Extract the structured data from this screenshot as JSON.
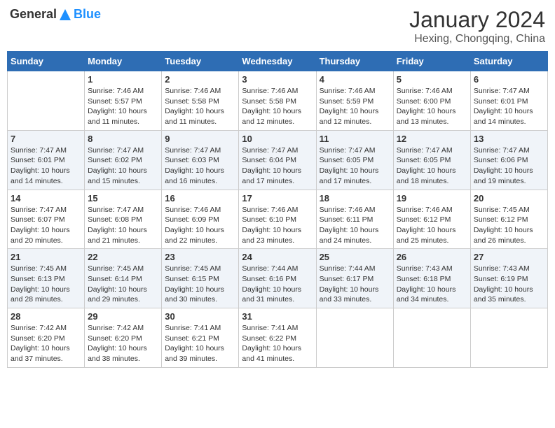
{
  "header": {
    "logo_general": "General",
    "logo_blue": "Blue",
    "month_title": "January 2024",
    "subtitle": "Hexing, Chongqing, China"
  },
  "days_of_week": [
    "Sunday",
    "Monday",
    "Tuesday",
    "Wednesday",
    "Thursday",
    "Friday",
    "Saturday"
  ],
  "weeks": [
    {
      "days": [
        {
          "num": "",
          "info": ""
        },
        {
          "num": "1",
          "info": "Sunrise: 7:46 AM\nSunset: 5:57 PM\nDaylight: 10 hours\nand 11 minutes."
        },
        {
          "num": "2",
          "info": "Sunrise: 7:46 AM\nSunset: 5:58 PM\nDaylight: 10 hours\nand 11 minutes."
        },
        {
          "num": "3",
          "info": "Sunrise: 7:46 AM\nSunset: 5:58 PM\nDaylight: 10 hours\nand 12 minutes."
        },
        {
          "num": "4",
          "info": "Sunrise: 7:46 AM\nSunset: 5:59 PM\nDaylight: 10 hours\nand 12 minutes."
        },
        {
          "num": "5",
          "info": "Sunrise: 7:46 AM\nSunset: 6:00 PM\nDaylight: 10 hours\nand 13 minutes."
        },
        {
          "num": "6",
          "info": "Sunrise: 7:47 AM\nSunset: 6:01 PM\nDaylight: 10 hours\nand 14 minutes."
        }
      ]
    },
    {
      "days": [
        {
          "num": "7",
          "info": "Sunrise: 7:47 AM\nSunset: 6:01 PM\nDaylight: 10 hours\nand 14 minutes."
        },
        {
          "num": "8",
          "info": "Sunrise: 7:47 AM\nSunset: 6:02 PM\nDaylight: 10 hours\nand 15 minutes."
        },
        {
          "num": "9",
          "info": "Sunrise: 7:47 AM\nSunset: 6:03 PM\nDaylight: 10 hours\nand 16 minutes."
        },
        {
          "num": "10",
          "info": "Sunrise: 7:47 AM\nSunset: 6:04 PM\nDaylight: 10 hours\nand 17 minutes."
        },
        {
          "num": "11",
          "info": "Sunrise: 7:47 AM\nSunset: 6:05 PM\nDaylight: 10 hours\nand 17 minutes."
        },
        {
          "num": "12",
          "info": "Sunrise: 7:47 AM\nSunset: 6:05 PM\nDaylight: 10 hours\nand 18 minutes."
        },
        {
          "num": "13",
          "info": "Sunrise: 7:47 AM\nSunset: 6:06 PM\nDaylight: 10 hours\nand 19 minutes."
        }
      ]
    },
    {
      "days": [
        {
          "num": "14",
          "info": "Sunrise: 7:47 AM\nSunset: 6:07 PM\nDaylight: 10 hours\nand 20 minutes."
        },
        {
          "num": "15",
          "info": "Sunrise: 7:47 AM\nSunset: 6:08 PM\nDaylight: 10 hours\nand 21 minutes."
        },
        {
          "num": "16",
          "info": "Sunrise: 7:46 AM\nSunset: 6:09 PM\nDaylight: 10 hours\nand 22 minutes."
        },
        {
          "num": "17",
          "info": "Sunrise: 7:46 AM\nSunset: 6:10 PM\nDaylight: 10 hours\nand 23 minutes."
        },
        {
          "num": "18",
          "info": "Sunrise: 7:46 AM\nSunset: 6:11 PM\nDaylight: 10 hours\nand 24 minutes."
        },
        {
          "num": "19",
          "info": "Sunrise: 7:46 AM\nSunset: 6:12 PM\nDaylight: 10 hours\nand 25 minutes."
        },
        {
          "num": "20",
          "info": "Sunrise: 7:45 AM\nSunset: 6:12 PM\nDaylight: 10 hours\nand 26 minutes."
        }
      ]
    },
    {
      "days": [
        {
          "num": "21",
          "info": "Sunrise: 7:45 AM\nSunset: 6:13 PM\nDaylight: 10 hours\nand 28 minutes."
        },
        {
          "num": "22",
          "info": "Sunrise: 7:45 AM\nSunset: 6:14 PM\nDaylight: 10 hours\nand 29 minutes."
        },
        {
          "num": "23",
          "info": "Sunrise: 7:45 AM\nSunset: 6:15 PM\nDaylight: 10 hours\nand 30 minutes."
        },
        {
          "num": "24",
          "info": "Sunrise: 7:44 AM\nSunset: 6:16 PM\nDaylight: 10 hours\nand 31 minutes."
        },
        {
          "num": "25",
          "info": "Sunrise: 7:44 AM\nSunset: 6:17 PM\nDaylight: 10 hours\nand 33 minutes."
        },
        {
          "num": "26",
          "info": "Sunrise: 7:43 AM\nSunset: 6:18 PM\nDaylight: 10 hours\nand 34 minutes."
        },
        {
          "num": "27",
          "info": "Sunrise: 7:43 AM\nSunset: 6:19 PM\nDaylight: 10 hours\nand 35 minutes."
        }
      ]
    },
    {
      "days": [
        {
          "num": "28",
          "info": "Sunrise: 7:42 AM\nSunset: 6:20 PM\nDaylight: 10 hours\nand 37 minutes."
        },
        {
          "num": "29",
          "info": "Sunrise: 7:42 AM\nSunset: 6:20 PM\nDaylight: 10 hours\nand 38 minutes."
        },
        {
          "num": "30",
          "info": "Sunrise: 7:41 AM\nSunset: 6:21 PM\nDaylight: 10 hours\nand 39 minutes."
        },
        {
          "num": "31",
          "info": "Sunrise: 7:41 AM\nSunset: 6:22 PM\nDaylight: 10 hours\nand 41 minutes."
        },
        {
          "num": "",
          "info": ""
        },
        {
          "num": "",
          "info": ""
        },
        {
          "num": "",
          "info": ""
        }
      ]
    }
  ]
}
